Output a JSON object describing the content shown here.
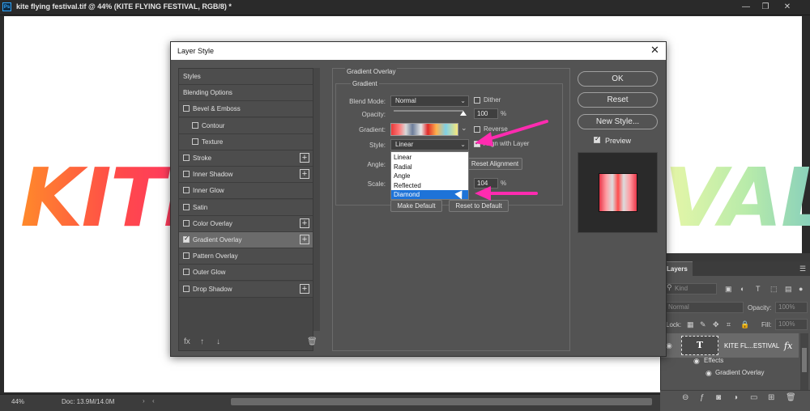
{
  "window": {
    "title": "kite flying festival.tif @ 44% (KITE FLYING FESTIVAL, RGB/8) *",
    "app_icon": "Ps",
    "controls": [
      "—",
      "❐",
      "✕"
    ]
  },
  "canvas": {
    "text_left": "KITE",
    "text_right": "VAL"
  },
  "status": {
    "zoom": "44%",
    "doc": "Doc: 13.9M/14.0M",
    "arrow_right": "›",
    "arrow_left": "‹"
  },
  "dialog": {
    "title": "Layer Style",
    "close": "✕",
    "styles": [
      {
        "label": "Styles",
        "checkbox": false,
        "checked": false,
        "plus": false,
        "indent": 0,
        "selected": false
      },
      {
        "label": "Blending Options",
        "checkbox": false,
        "checked": false,
        "plus": false,
        "indent": 0,
        "selected": false
      },
      {
        "label": "Bevel & Emboss",
        "checkbox": true,
        "checked": false,
        "plus": false,
        "indent": 0,
        "selected": false
      },
      {
        "label": "Contour",
        "checkbox": true,
        "checked": false,
        "plus": false,
        "indent": 1,
        "selected": false
      },
      {
        "label": "Texture",
        "checkbox": true,
        "checked": false,
        "plus": false,
        "indent": 1,
        "selected": false
      },
      {
        "label": "Stroke",
        "checkbox": true,
        "checked": false,
        "plus": true,
        "indent": 0,
        "selected": false
      },
      {
        "label": "Inner Shadow",
        "checkbox": true,
        "checked": false,
        "plus": true,
        "indent": 0,
        "selected": false
      },
      {
        "label": "Inner Glow",
        "checkbox": true,
        "checked": false,
        "plus": false,
        "indent": 0,
        "selected": false
      },
      {
        "label": "Satin",
        "checkbox": true,
        "checked": false,
        "plus": false,
        "indent": 0,
        "selected": false
      },
      {
        "label": "Color Overlay",
        "checkbox": true,
        "checked": false,
        "plus": true,
        "indent": 0,
        "selected": false
      },
      {
        "label": "Gradient Overlay",
        "checkbox": true,
        "checked": true,
        "plus": true,
        "indent": 0,
        "selected": true
      },
      {
        "label": "Pattern Overlay",
        "checkbox": true,
        "checked": false,
        "plus": false,
        "indent": 0,
        "selected": false
      },
      {
        "label": "Outer Glow",
        "checkbox": true,
        "checked": false,
        "plus": false,
        "indent": 0,
        "selected": false
      },
      {
        "label": "Drop Shadow",
        "checkbox": true,
        "checked": false,
        "plus": true,
        "indent": 0,
        "selected": false
      }
    ],
    "footer_icons": [
      "fx",
      "↑",
      "↓",
      "🗑"
    ],
    "panel_title": "Gradient Overlay",
    "group_title": "Gradient",
    "blend_mode": {
      "label": "Blend Mode:",
      "value": "Normal"
    },
    "dither": {
      "label": "Dither",
      "checked": false
    },
    "opacity": {
      "label": "Opacity:",
      "value": "100",
      "unit": "%",
      "level": 1.0
    },
    "gradient": {
      "label": "Gradient:"
    },
    "reverse": {
      "label": "Reverse",
      "checked": false
    },
    "style": {
      "label": "Style:",
      "value": "Linear",
      "options": [
        "Linear",
        "Radial",
        "Angle",
        "Reflected",
        "Diamond"
      ],
      "highlighted": "Diamond"
    },
    "align": {
      "label": "Align with Layer",
      "checked": true
    },
    "angle": {
      "label": "Angle:"
    },
    "reset_alignment": "Reset Alignment",
    "scale": {
      "label": "Scale:",
      "value": "104",
      "unit": "%"
    },
    "make_default": "Make Default",
    "reset_default": "Reset to Default",
    "ok": "OK",
    "cancel": "Reset",
    "new_style": "New Style...",
    "preview": {
      "label": "Preview",
      "checked": true
    }
  },
  "layers": {
    "tab": "Layers",
    "kind": "Kind",
    "blend": "Normal",
    "opacity_label": "Opacity:",
    "opacity_value": "100%",
    "lock_label": "Lock:",
    "fill_label": "Fill:",
    "fill_value": "100%",
    "layer_name": "KITE FL...ESTIVAL",
    "thumb_glyph": "T",
    "fx": "fx",
    "effects": "Effects",
    "gradient_overlay": "Gradient Overlay"
  },
  "colors": {
    "annotation_arrow": "#ff2bb0",
    "highlight": "#1e73d8"
  }
}
